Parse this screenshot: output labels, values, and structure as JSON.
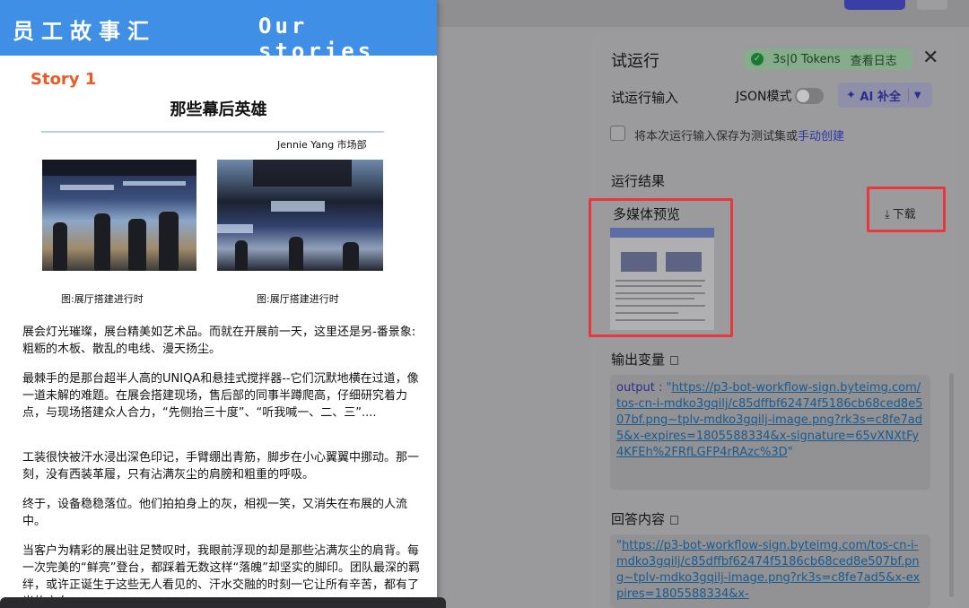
{
  "background": {
    "colors": {
      "overlay": "#9a9a9c",
      "accent": "#3a3fa8"
    }
  },
  "panel": {
    "title": "试运行",
    "status": {
      "duration": "3s",
      "separator": "|",
      "tokens": "0 Tokens",
      "view_log": "查看日志",
      "icon": "check-circle-icon"
    },
    "close_icon": "close-icon",
    "input_label": "试运行输入",
    "json_mode_label": "JSON模式",
    "ai_button_label": "AI 补全",
    "save_checkbox_text": "将本次运行输入保存为测试集或",
    "manual_create_link": "手动创建",
    "result_label": "运行结果",
    "media_preview_label": "多媒体预览",
    "download_label": "下载",
    "output_var_label": "输出变量",
    "output_key": "output",
    "output_url": "https://p3-bot-workflow-sign.byteimg.com/tos-cn-i-mdko3gqilj/c85dffbf62474f5186cb68ced8e507bf.png~tplv-mdko3gqilj-image.png?rk3s=c8fe7ad5&x-expires=1805588334&x-signature=65vXNXtFy4KFEh%2FRfLGFP4rRAzc%3D",
    "answer_label": "回答内容",
    "answer_url": "https://p3-bot-workflow-sign.byteimg.com/tos-cn-i-mdko3gqilj/c85dffbf62474f5186cb68ced8e507bf.png~tplv-mdko3gqilj-image.png?rk3s=c8fe7ad5&x-expires=1805588334&x-"
  },
  "doc": {
    "banner_cn": "员工故事汇",
    "banner_en": "Our stories",
    "story_tag": "Story 1",
    "title": "那些幕后英雄",
    "author": "Jennie Yang 市场部",
    "caption1": "图:展厅搭建进行时",
    "caption2": "图:展厅搭建进行时",
    "p1": "展会灯光璀璨，展台精美如艺术品。而就在开展前一天，这里还是另-番景象:粗粝的木板、散乱的电线、漫天扬尘。",
    "p2": "最棘手的是那台超半人高的UNIQA和悬挂式搅拌器--它们沉默地横在过道，像一道未解的难题。在展会搭建现场，售后部的同事半蹲爬高，仔细研究着力点，与现场搭建众人合力，“先侧抬三十度”、“听我喊一、二、三”....",
    "p3": "工装很快被汗水浸出深色印记，手臂绷出青筋，脚步在小心翼翼中挪动。那一刻，没有西装革履，只有沾满灰尘的肩膀和粗重的呼吸。",
    "p4": "终于，设备稳稳落位。他们拍拍身上的灰，相视一笑，又消失在布展的人流中。",
    "p5": "当客户为精彩的展出驻足赞叹时，我眼前浮现的却是那些沾满灰尘的肩背。每一次完美的“鲜亮”登台，都踩着无数这样“落魄”却坚实的脚印。团队最深的羁绊，或许正诞生于这些无人看见的、汗水交融的时刻一它让所有辛苦，都有了光的方向。",
    "colors": {
      "banner": "#3f8fe7",
      "story_tag": "#ec5a24"
    }
  }
}
